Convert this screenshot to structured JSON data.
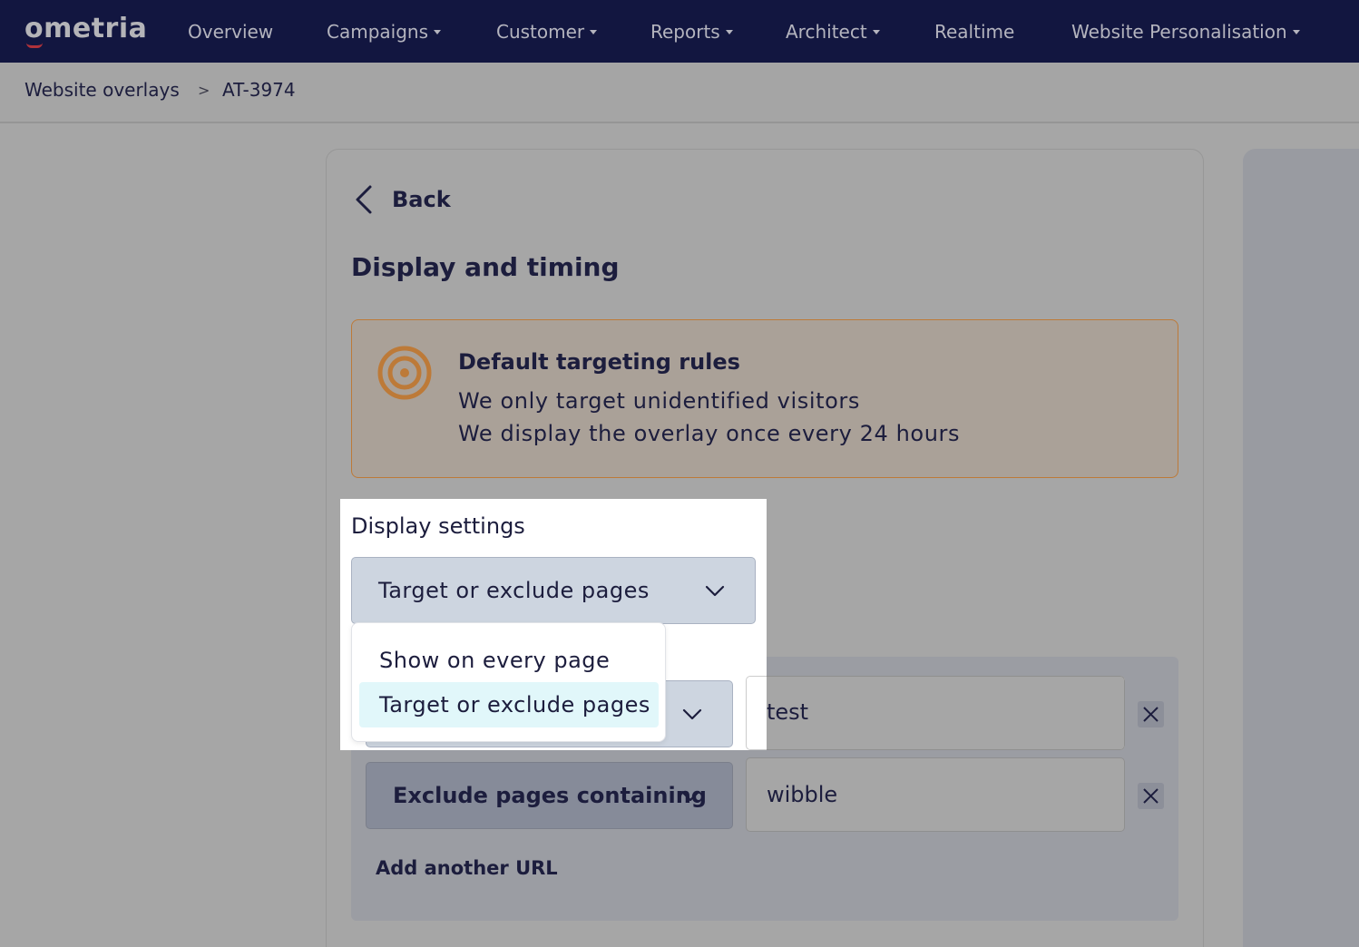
{
  "brand": {
    "logo_text": "ometria",
    "nav_bg": "#121640",
    "accent": "#bd7a38"
  },
  "nav": {
    "items": [
      {
        "label": "Overview",
        "has_caret": false
      },
      {
        "label": "Campaigns",
        "has_caret": true
      },
      {
        "label": "Customer",
        "has_caret": true
      },
      {
        "label": "Reports",
        "has_caret": true
      },
      {
        "label": "Architect",
        "has_caret": true
      },
      {
        "label": "Realtime",
        "has_caret": false
      },
      {
        "label": "Website Personalisation",
        "has_caret": true
      }
    ]
  },
  "breadcrumb": {
    "items": [
      "Website overlays",
      "AT-3974"
    ],
    "separator": ">"
  },
  "card": {
    "back_label": "Back",
    "title": "Display and timing"
  },
  "banner": {
    "icon": "target-icon",
    "title": "Default targeting rules",
    "lines": [
      "We only target unidentified visitors",
      "We display the overlay once every 24 hours"
    ]
  },
  "display_settings": {
    "label": "Display settings",
    "selected": "Target or exclude pages",
    "options": [
      {
        "label": "Show on every page",
        "selected": false
      },
      {
        "label": "Target or exclude pages",
        "selected": true
      }
    ]
  },
  "url_rules": [
    {
      "rule": "Target or exclude pages",
      "value": "test"
    },
    {
      "rule": "Exclude pages containing",
      "value": "wibble"
    }
  ],
  "add_url_label": "Add another URL"
}
